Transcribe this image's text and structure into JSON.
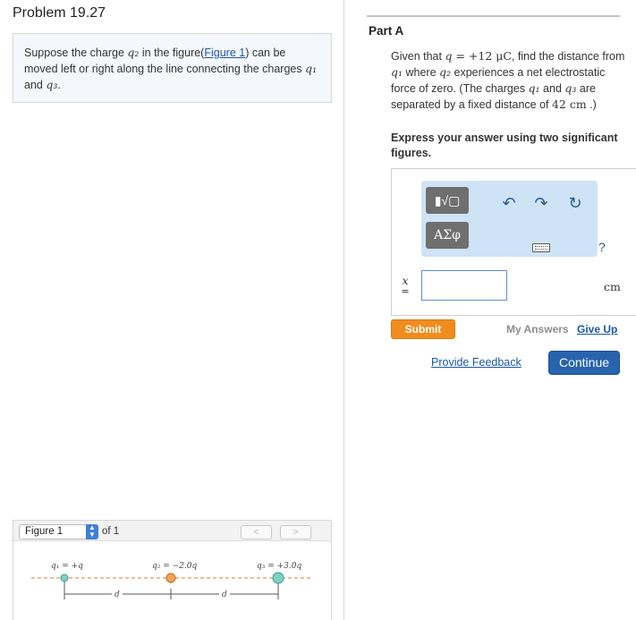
{
  "problem": {
    "title": "Problem 19.27",
    "question": {
      "text_before": "Suppose the charge ",
      "q2": "q₂",
      "text_mid": " in the figure(",
      "figure_link": "Figure 1",
      "text_after": ") can be moved left or right along the line connecting the charges ",
      "q1": "q₁",
      "and": " and ",
      "q3": "q₃",
      "end": "."
    }
  },
  "figure": {
    "select_label": "Figure 1",
    "of_label": "of 1",
    "prev_icon": "chevron-left-icon",
    "next_icon": "chevron-right-icon",
    "charges": [
      {
        "label": "q₁ = +q",
        "color": "#7fd1c4"
      },
      {
        "label": "q₂ = −2.0q",
        "color": "#f2a25a"
      },
      {
        "label": "q₃ = +3.0q",
        "color": "#7fd1c4"
      }
    ],
    "distance_label_1": "d",
    "distance_label_2": "d"
  },
  "part": {
    "title": "Part A",
    "q_given": "Given that ",
    "q_eq": "q",
    "q_eq_val": " = +12 μC",
    "q_text1": ", find the distance from ",
    "q1": "q₁",
    "q_text2": " where ",
    "q2": "q₂",
    "q_text3": " experiences a net electrostatic force of zero. (The charges ",
    "q1b": "q₁",
    "q_text4": " and ",
    "q3": "q₃",
    "q_text5": " are separated by a fixed distance of ",
    "distance": "42 cm",
    "q_text6": " .)",
    "instructions": "Express your answer using two significant figures."
  },
  "answer": {
    "variable": "x",
    "equals": "=",
    "value": "",
    "unit": "cm",
    "template_label": "▮√▢",
    "greek_label": "ΑΣφ",
    "undo_icon": "undo-icon",
    "redo_icon": "redo-icon",
    "reset_icon": "reset-icon",
    "keyboard_icon": "keyboard-icon",
    "help_label": "?"
  },
  "actions": {
    "submit": "Submit",
    "my_answers": "My Answers",
    "give_up": "Give Up",
    "feedback": "Provide Feedback",
    "continue": "Continue"
  },
  "colors": {
    "submit": "#f18c1f",
    "continue": "#2864ae",
    "link": "#1a58a6",
    "toolbar": "#cfe3f7"
  }
}
